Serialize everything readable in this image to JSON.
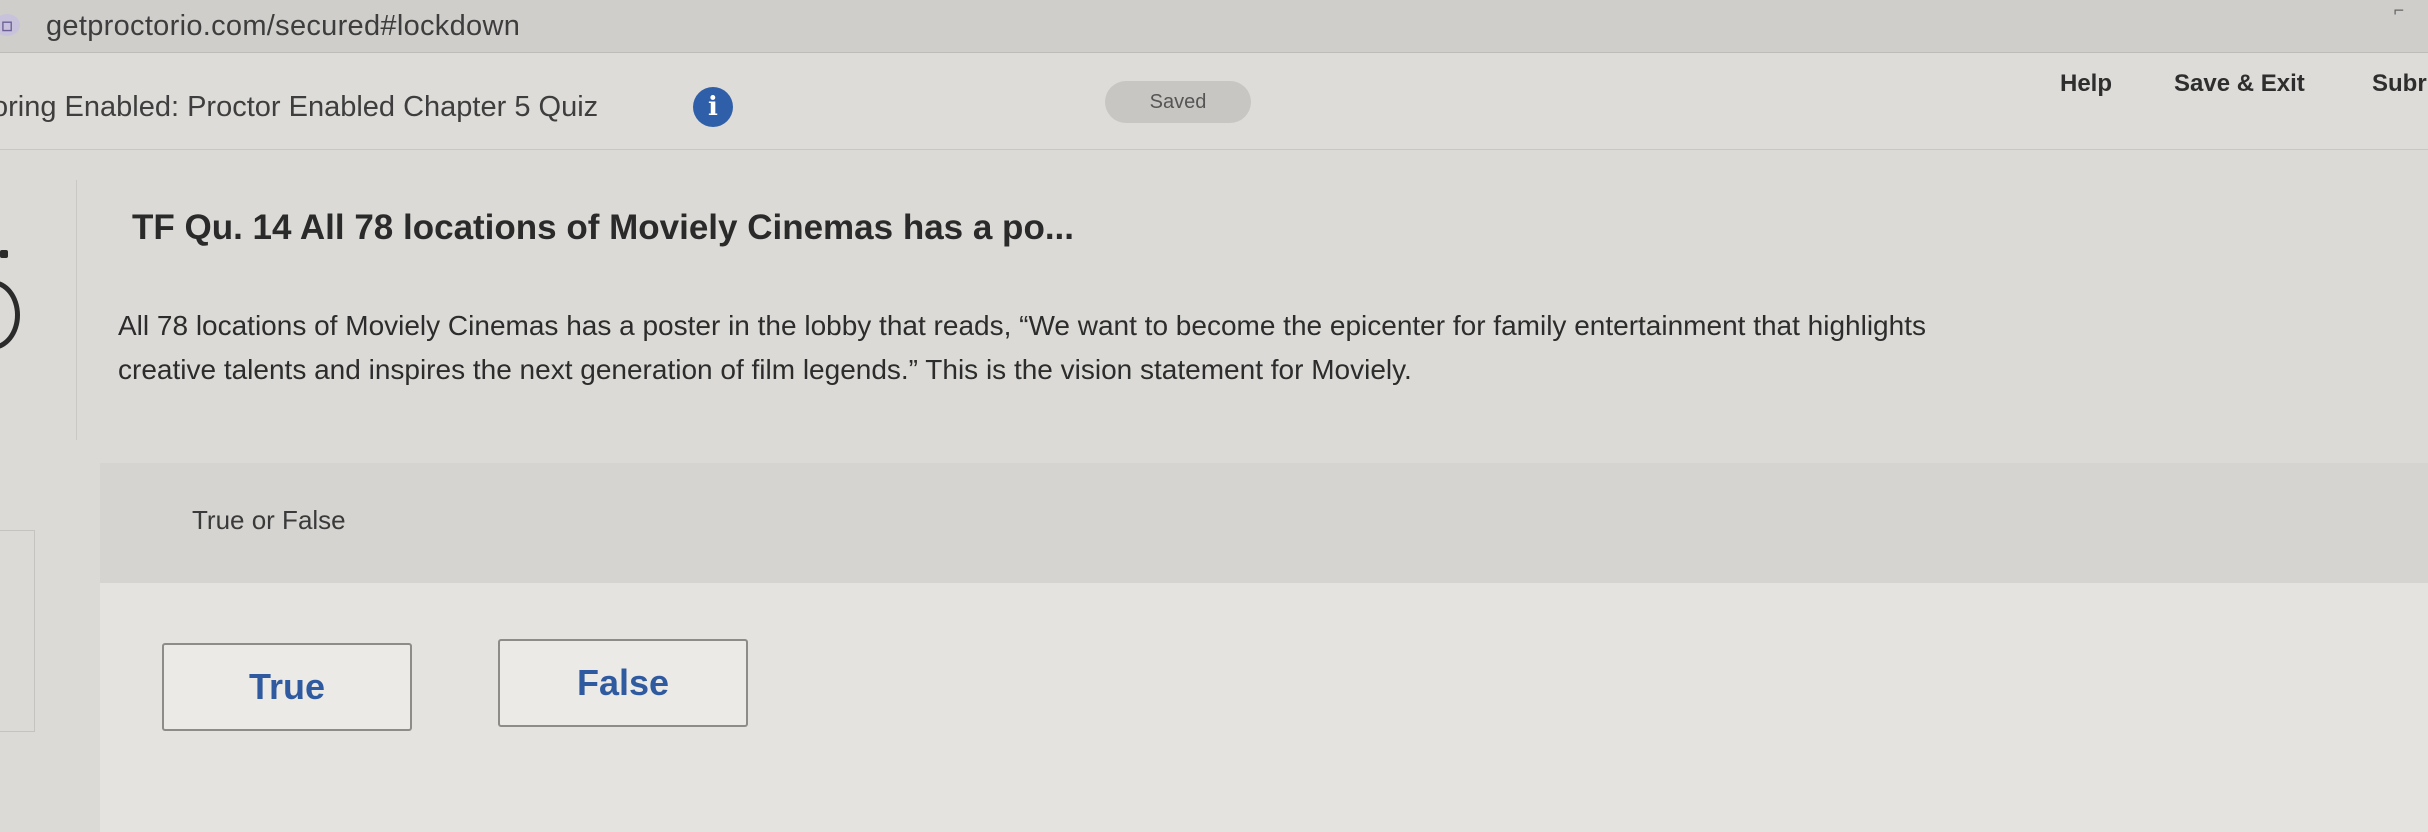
{
  "browser": {
    "url": "getproctorio.com/secured#lockdown",
    "site_icon": "proctorio-extension-icon"
  },
  "header": {
    "title": "oring Enabled: Proctor Enabled Chapter 5 Quiz",
    "status": "Saved",
    "links": {
      "help": "Help",
      "save_exit": "Save & Exit",
      "submit": "Subr"
    }
  },
  "question": {
    "heading": "TF Qu. 14 All 78 locations of Moviely Cinemas has a po...",
    "line1": "All 78 locations of Moviely Cinemas has a poster in the lobby that reads, “We want to become the epicenter for family entertainment that highlights",
    "line2": "creative talents and inspires the next generation of film legends.” This is the vision statement for Moviely."
  },
  "answers": {
    "prompt": "True or False",
    "options": [
      "True",
      "False"
    ]
  },
  "colors": {
    "accent": "#2f5fa8",
    "button_text": "#2f5aa0"
  }
}
